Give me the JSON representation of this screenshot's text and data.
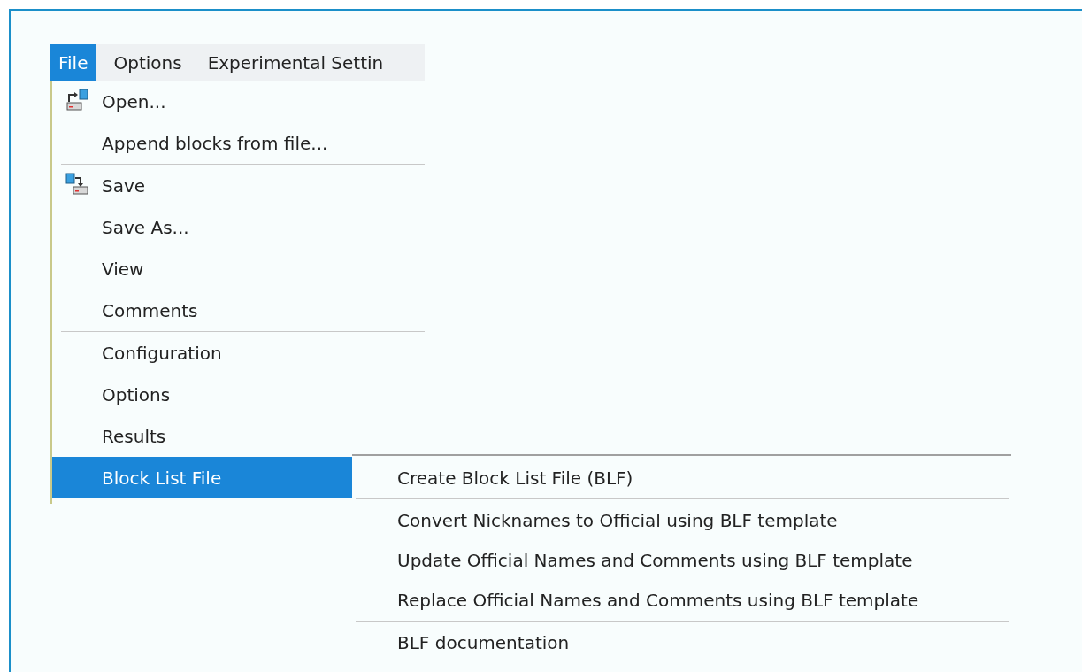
{
  "menubar": [
    {
      "label": "File",
      "selected": true
    },
    {
      "label": "Options",
      "selected": false
    },
    {
      "label": "Experimental Settin",
      "selected": false
    }
  ],
  "file_menu": [
    {
      "kind": "icon_item",
      "label": "Open...",
      "selected": false
    },
    {
      "kind": "item",
      "label": "Append blocks from file...",
      "selected": false
    },
    {
      "kind": "separator"
    },
    {
      "kind": "icon_item",
      "label": "Save",
      "selected": false
    },
    {
      "kind": "item",
      "label": "Save As...",
      "selected": false
    },
    {
      "kind": "item",
      "label": "View",
      "selected": false
    },
    {
      "kind": "item",
      "label": "Comments",
      "selected": false
    },
    {
      "kind": "separator"
    },
    {
      "kind": "item",
      "label": "Configuration",
      "selected": false
    },
    {
      "kind": "item",
      "label": "Options",
      "selected": false
    },
    {
      "kind": "item",
      "label": "Results",
      "selected": false
    },
    {
      "kind": "item",
      "label": "Block List File",
      "selected": true
    }
  ],
  "submenu": [
    {
      "kind": "item",
      "label": "Create Block List File (BLF)"
    },
    {
      "kind": "separator"
    },
    {
      "kind": "item",
      "label": "Convert Nicknames to Official using BLF template"
    },
    {
      "kind": "item",
      "label": "Update Official Names and Comments using BLF template"
    },
    {
      "kind": "item",
      "label": "Replace Official Names and Comments using BLF template"
    },
    {
      "kind": "separator"
    },
    {
      "kind": "item",
      "label": "BLF documentation"
    }
  ]
}
